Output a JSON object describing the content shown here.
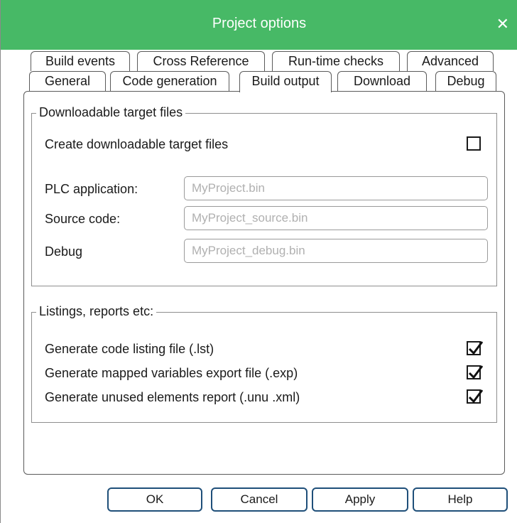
{
  "window": {
    "title": "Project options",
    "close_glyph": "✕",
    "accent_color": "#47b966"
  },
  "tabs": {
    "row1": [
      {
        "label": "Build events"
      },
      {
        "label": "Cross Reference"
      },
      {
        "label": "Run-time checks"
      },
      {
        "label": "Advanced"
      }
    ],
    "row2": [
      {
        "label": "General"
      },
      {
        "label": "Code generation"
      },
      {
        "label": "Build output",
        "active": true
      },
      {
        "label": "Download"
      },
      {
        "label": "Debug"
      }
    ]
  },
  "downloadable": {
    "title": "Downloadable target files",
    "create_label": "Create downloadable target files",
    "create_checked": false,
    "fields": [
      {
        "label": "PLC application:",
        "value": "MyProject.bin"
      },
      {
        "label": "Source code:",
        "value": "MyProject_source.bin"
      },
      {
        "label": "Debug",
        "value": "MyProject_debug.bin"
      }
    ]
  },
  "listings": {
    "title": "Listings, reports etc:",
    "items": [
      {
        "label": "Generate code listing file (.lst)",
        "checked": true
      },
      {
        "label": "Generate mapped variables export file (.exp)",
        "checked": true
      },
      {
        "label": "Generate unused elements report (.unu .xml)",
        "checked": true
      }
    ]
  },
  "buttons": {
    "ok": "OK",
    "cancel": "Cancel",
    "apply": "Apply",
    "help": "Help"
  }
}
